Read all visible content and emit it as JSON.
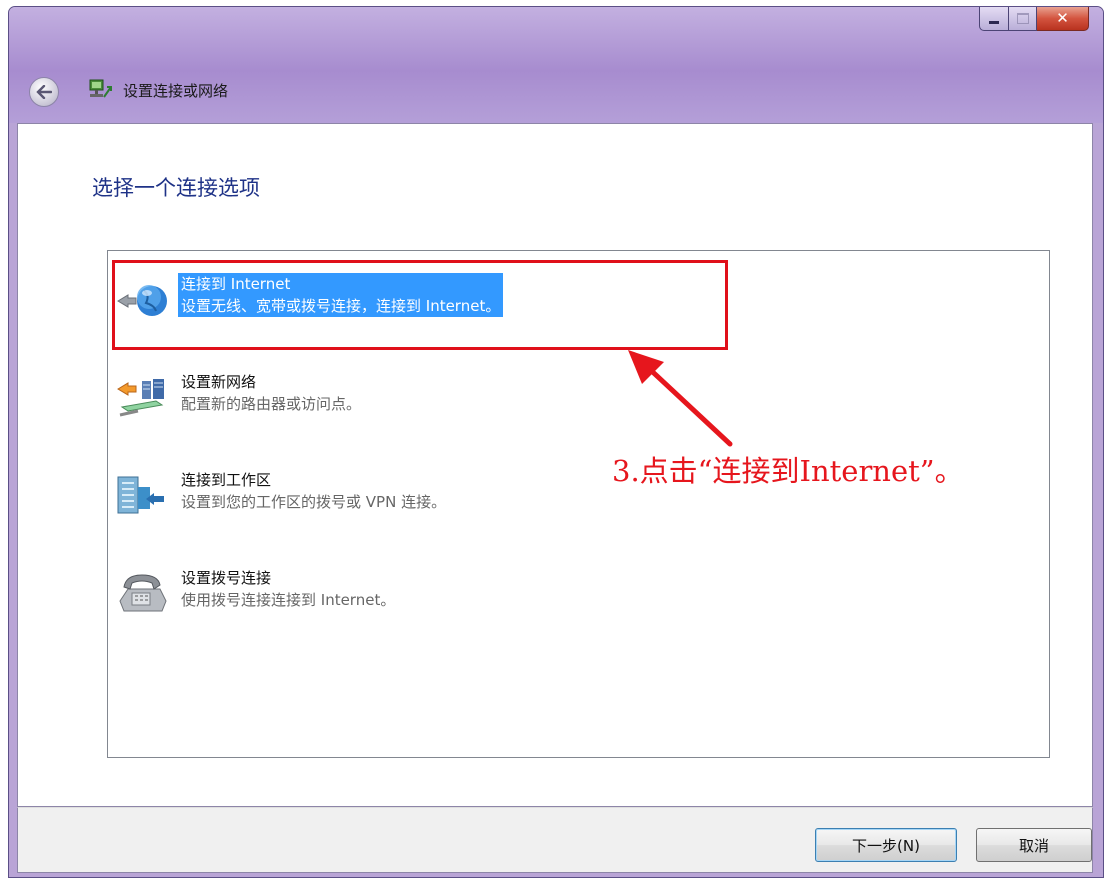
{
  "window": {
    "title": "设置连接或网络",
    "caption": {
      "minimize": "minimize",
      "maximize": "maximize",
      "close": "close"
    }
  },
  "heading": "选择一个连接选项",
  "options": [
    {
      "title": "连接到 Internet",
      "desc": "设置无线、宽带或拨号连接，连接到 Internet。",
      "icon": "globe-icon",
      "selected": true
    },
    {
      "title": "设置新网络",
      "desc": "配置新的路由器或访问点。",
      "icon": "router-icon",
      "selected": false
    },
    {
      "title": "连接到工作区",
      "desc": "设置到您的工作区的拨号或 VPN 连接。",
      "icon": "workplace-icon",
      "selected": false
    },
    {
      "title": "设置拨号连接",
      "desc": "使用拨号连接连接到 Internet。",
      "icon": "phone-icon",
      "selected": false
    }
  ],
  "annotation": "3.点击“连接到Internet”。",
  "buttons": {
    "next": "下一步(N)",
    "cancel": "取消"
  },
  "colors": {
    "accent": "#3399ff",
    "heading": "#1e3287",
    "annotation": "#e6161d",
    "titlebar": "#b9a4d6"
  }
}
